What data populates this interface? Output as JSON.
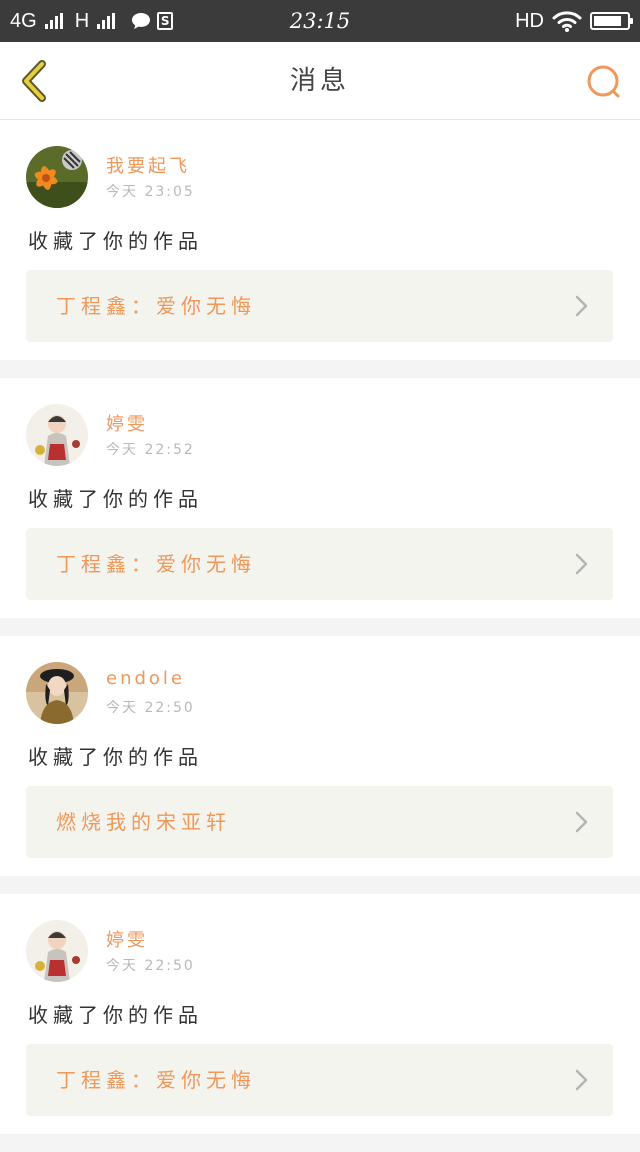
{
  "status_bar": {
    "network": "4G",
    "network2": "H",
    "time": "23:15",
    "hd": "HD",
    "battery_level": 0.85
  },
  "header": {
    "title": "消息",
    "icons": {
      "back": "chevron-left-icon",
      "search": "search-icon"
    },
    "accent_color": "#f0975a"
  },
  "messages": [
    {
      "user": "我要起飞",
      "time": "今天  23:05",
      "action": "收藏了你的作品",
      "work": "丁程鑫：爱你无悔"
    },
    {
      "user": "婷雯",
      "time": "今天  22:52",
      "action": "收藏了你的作品",
      "work": "丁程鑫：爱你无悔"
    },
    {
      "user": "endole",
      "time": "今天  22:50",
      "action": "收藏了你的作品",
      "work": "燃烧我的宋亚轩"
    },
    {
      "user": "婷雯",
      "time": "今天  22:50",
      "action": "收藏了你的作品",
      "work": "丁程鑫：爱你无悔"
    }
  ]
}
